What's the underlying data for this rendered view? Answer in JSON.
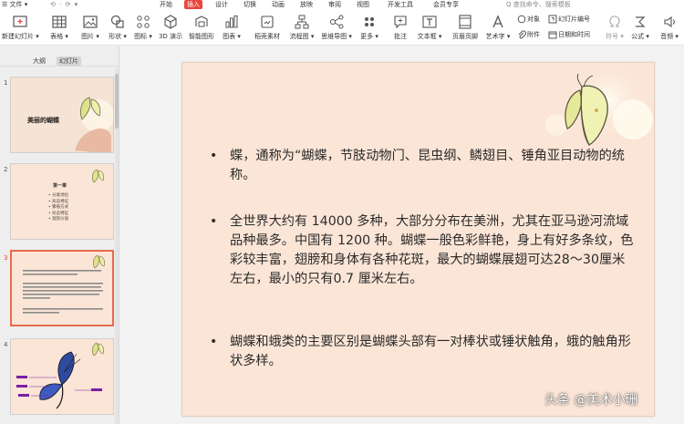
{
  "menubar": {
    "file": "☰ 文件 ▾",
    "quick_access": "⟲ · ⟳ ▾",
    "tabs": [
      "开始",
      "插入",
      "设计",
      "切换",
      "动画",
      "放映",
      "审阅",
      "视图",
      "开发工具",
      "会员专享"
    ],
    "active_tab": 1,
    "search": "Q 查找命令、搜索模板",
    "accent": "#e8453c"
  },
  "ribbon": {
    "new_slide": "新建幻灯片 ▾",
    "table": "表格 ▾",
    "picture": "图片 ▾",
    "shape": "形状 ▾",
    "icon": "图标 ▾",
    "model3d": "3D 演示",
    "smartart": "智能图形",
    "chart": "图表 ▾",
    "material": "稻壳素材",
    "flowchart": "流程图 ▾",
    "mindmap": "思维导图 ▾",
    "more": "更多 ▾",
    "comment": "批注",
    "textbox": "文本框 ▾",
    "header_footer": "页眉页脚",
    "wordart": "艺术字 ▾",
    "object": "对象",
    "slide_number": "幻灯片编号",
    "attachment": "附件",
    "datetime": "日期和时间",
    "symbol": "符号 ▾",
    "formula": "公式 ▾",
    "media": "音频 ▾"
  },
  "left_panel": {
    "tabs": [
      "大纲",
      "幻灯片"
    ],
    "active_tab": 1,
    "slides": [
      {
        "number": "1",
        "title": "美丽的蝴蝶"
      },
      {
        "number": "2",
        "heading": "第一章",
        "items": [
          "• 分类地位",
          "• 形态特征",
          "• 繁殖方式",
          "• 形态特征",
          "• 观赏价值"
        ]
      },
      {
        "number": "3",
        "selected": true
      },
      {
        "number": "4"
      }
    ]
  },
  "slide": {
    "bullets": [
      "蝶，通称为“蝴蝶，节肢动物门、昆虫纲、鳞翅目、锤角亚目动物的统称。",
      "全世界大约有 14000 多种，大部分分布在美洲，尤其在亚马逊河流域品种最多。中国有 1200 种。蝴蝶一般色彩鲜艳，身上有好多条纹，色彩较丰富，翅膀和身体有各种花斑，最大的蝴蝶展翅可达28～30厘米左右，最小的只有0.7 厘米左右。",
      "蝴蝶和蛾类的主要区别是蝴蝶头部有一对棒状或锤状触角，蛾的触角形状多样。"
    ],
    "background": "#fbe5d6"
  },
  "watermark": "头条 @美术小珊"
}
